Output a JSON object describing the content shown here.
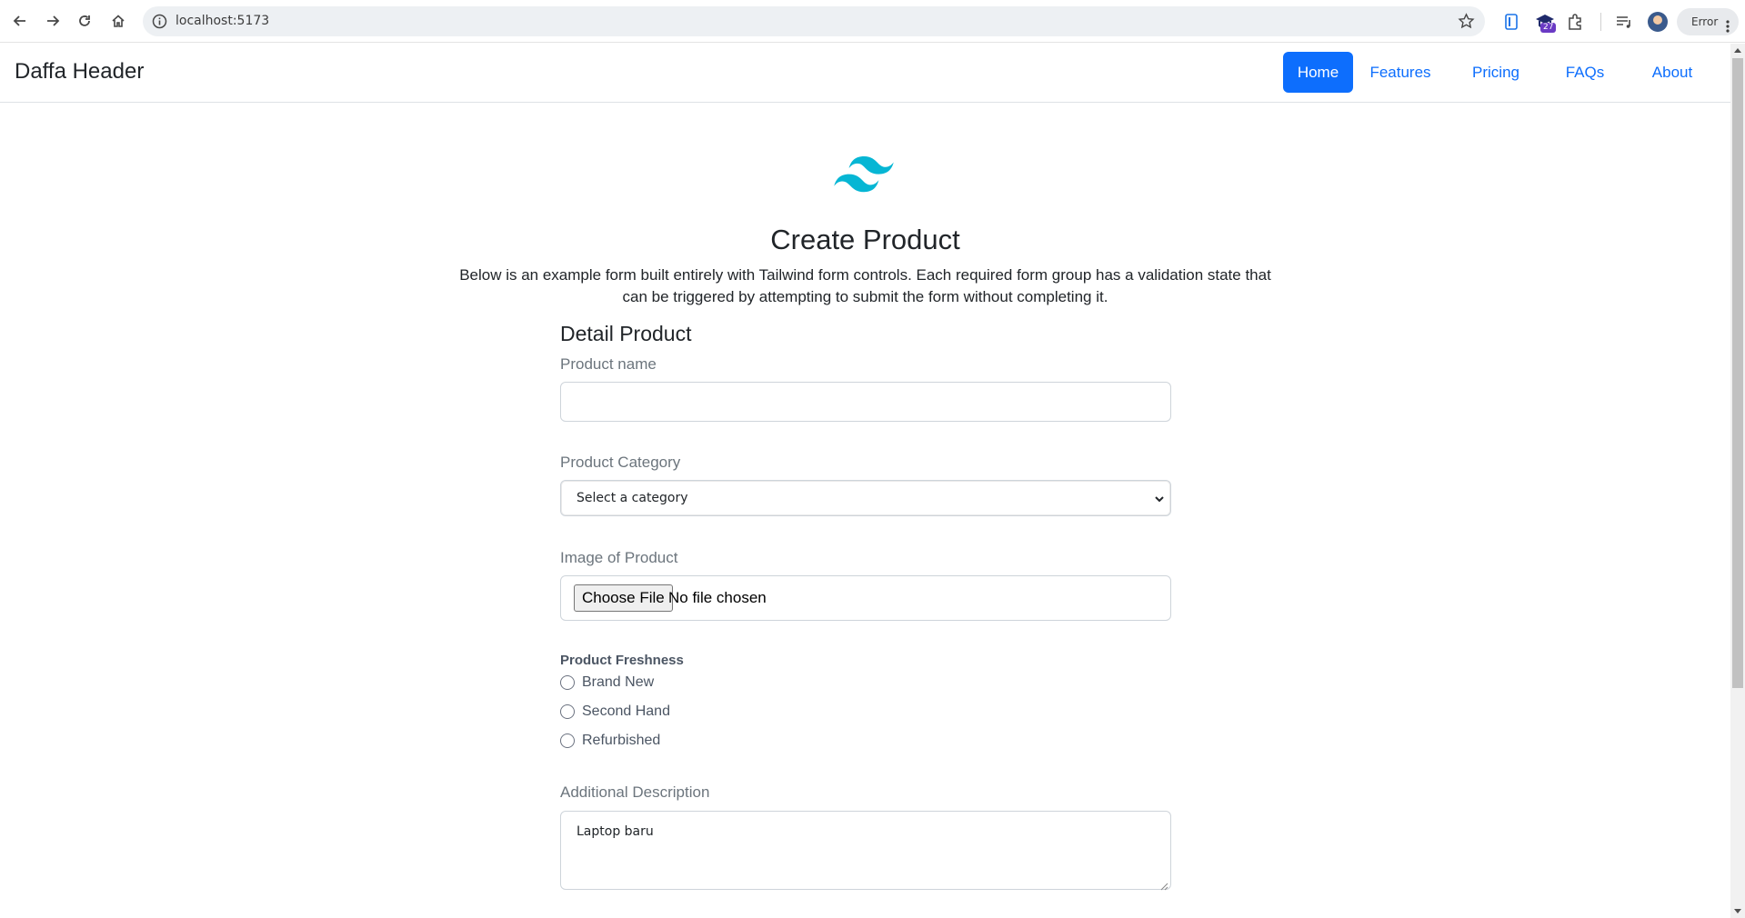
{
  "browser": {
    "url": "localhost:5173",
    "extension_badge": "27",
    "profile_status": "Error"
  },
  "header": {
    "brand": "Daffa Header",
    "nav": [
      {
        "label": "Home",
        "active": true
      },
      {
        "label": "Features",
        "active": false
      },
      {
        "label": "Pricing",
        "active": false
      },
      {
        "label": "FAQs",
        "active": false
      },
      {
        "label": "About",
        "active": false
      }
    ]
  },
  "intro": {
    "title": "Create Product",
    "description": "Below is an example form built entirely with Tailwind form controls. Each required form group has a validation state that can be triggered by attempting to submit the form without completing it."
  },
  "form": {
    "section_title": "Detail Product",
    "product_name": {
      "label": "Product name",
      "value": ""
    },
    "product_category": {
      "label": "Product Category",
      "selected": "Select a category"
    },
    "image": {
      "label": "Image of Product",
      "button": "Choose File",
      "status": "No file chosen"
    },
    "freshness": {
      "label": "Product Freshness",
      "options": [
        "Brand New",
        "Second Hand",
        "Refurbished"
      ],
      "selected": null
    },
    "description": {
      "label": "Additional Description",
      "value": "Laptop baru"
    }
  },
  "colors": {
    "primary": "#0d6efd",
    "logo": "#06b6d4",
    "border": "#ced4da",
    "muted_label": "#6c757d"
  }
}
